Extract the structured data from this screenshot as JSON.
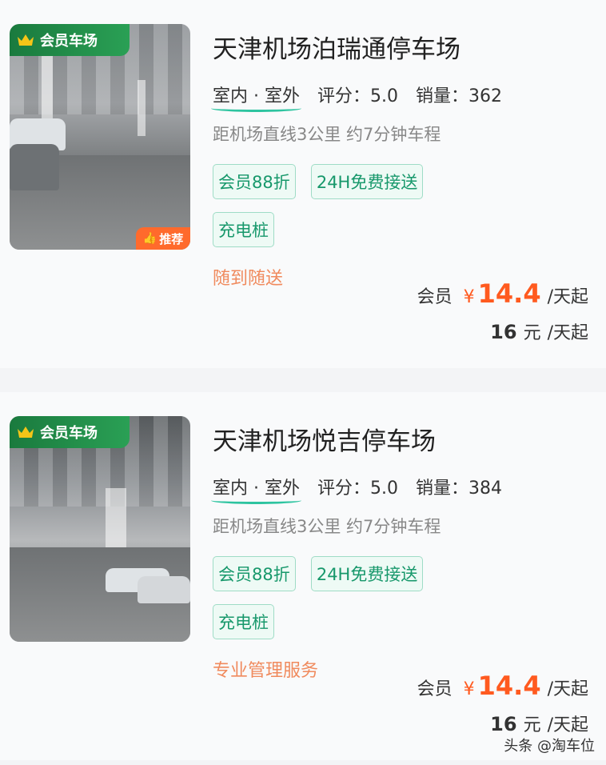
{
  "listings": [
    {
      "member_badge": "会员车场",
      "recommend_badge": "推荐",
      "name": "天津机场泊瑞通停车场",
      "type": "室内 · 室外",
      "rating": "评分：5.0",
      "sales": "销量：362",
      "distance": "距机场直线3公里 约7分钟车程",
      "tags": [
        "会员88折",
        "24H免费接送",
        "充电桩"
      ],
      "note": "随到随送",
      "member_label": "会员",
      "currency": "¥",
      "member_price": "14.4",
      "price_unit": "/天起",
      "regular_price": "16",
      "regular_currency": "元",
      "regular_unit": "/天起"
    },
    {
      "member_badge": "会员车场",
      "name": "天津机场悦吉停车场",
      "type": "室内 · 室外",
      "rating": "评分：5.0",
      "sales": "销量：384",
      "distance": "距机场直线3公里 约7分钟车程",
      "tags": [
        "会员88折",
        "24H免费接送",
        "充电桩"
      ],
      "note": "专业管理服务",
      "member_label": "会员",
      "currency": "¥",
      "member_price": "14.4",
      "price_unit": "/天起",
      "regular_price": "16",
      "regular_currency": "元",
      "regular_unit": "/天起"
    }
  ],
  "watermark": "头条 @淘车位",
  "colors": {
    "accent_green": "#17986b",
    "badge_green": "#1a7a3e",
    "price_orange": "#ff5a1f",
    "note_orange": "#f08a5d"
  },
  "icons": [
    "crown-icon",
    "thumbs-up-icon"
  ]
}
